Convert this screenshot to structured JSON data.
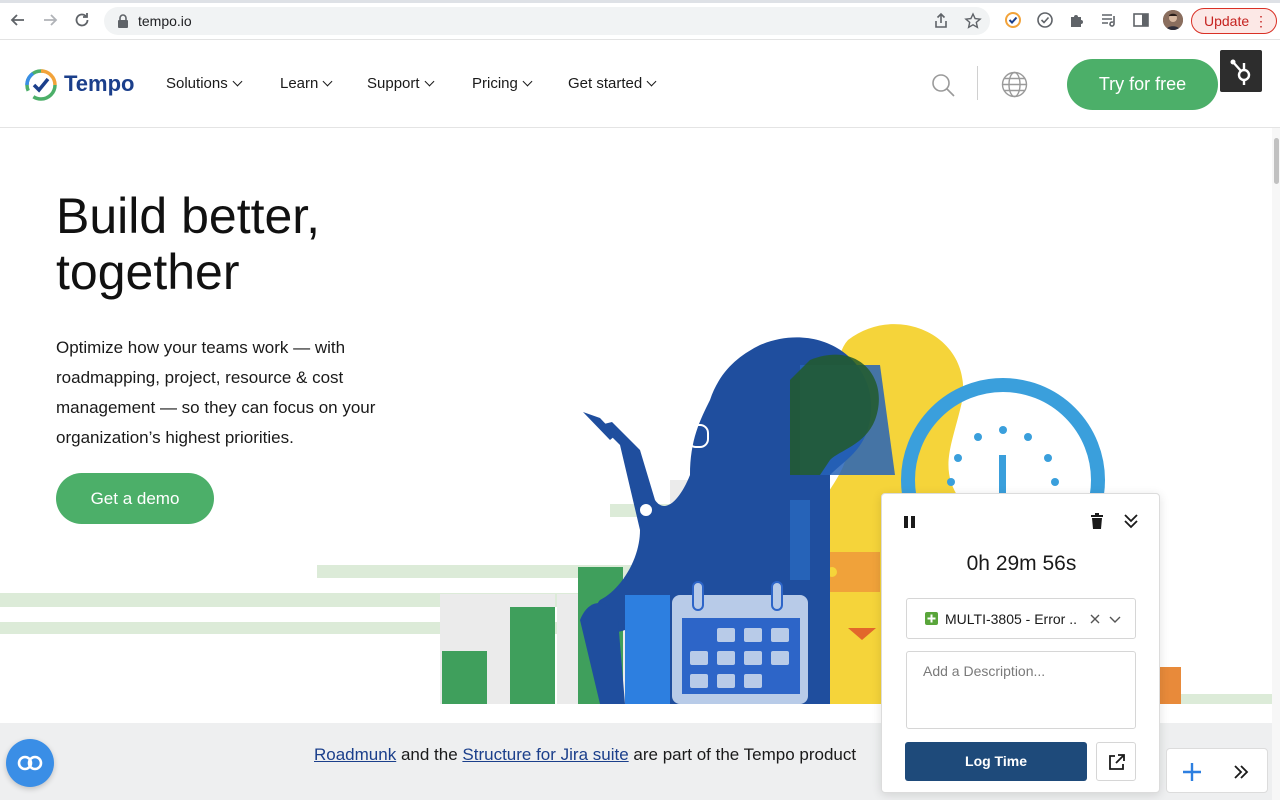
{
  "browser": {
    "url": "tempo.io",
    "update_label": "Update",
    "update_menu": "⋮"
  },
  "header": {
    "logo_text": "Tempo",
    "nav": [
      {
        "label": "Solutions"
      },
      {
        "label": "Learn"
      },
      {
        "label": "Support"
      },
      {
        "label": "Pricing"
      },
      {
        "label": "Get started"
      }
    ],
    "cta_label": "Try for free"
  },
  "hero": {
    "title_line1": "Build better,",
    "title_line2": "together",
    "body": "Optimize how your teams work — with roadmapping, project, resource & cost management — so they can focus on your organization’s highest priorities.",
    "demo_label": "Get a demo"
  },
  "band": {
    "link1": "Roadmunk",
    "text1": " and the ",
    "link2": "Structure for Jira suite",
    "text2": " are part of the Tempo product"
  },
  "timer": {
    "elapsed": "0h 29m 56s",
    "issue": "MULTI-3805 - Error ..",
    "description_placeholder": "Add a Description...",
    "log_label": "Log Time"
  },
  "colors": {
    "accent_green": "#4caf69",
    "brand_blue": "#1b3f8b",
    "log_button": "#1e4a7a"
  }
}
